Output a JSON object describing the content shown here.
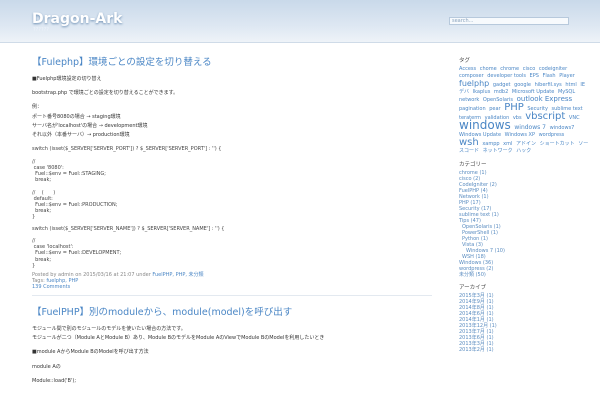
{
  "header": {
    "title": "Dragon-Ark",
    "tagline": "??????",
    "search_placeholder": "search..."
  },
  "posts": [
    {
      "title": "【Fulephp】環境ごとの設定を切り替える",
      "intro": "■Fuelphp環境設定の切り替え",
      "para1": "bootstrap.php で環境ごとの設定を切り替えることができます。",
      "notes": [
        "例：",
        "ポート番号8080の場合 → staging環境",
        "サーバ名が'localhost'の場合 → development環境",
        "それ以外（本番サーバ）→ production環境"
      ],
      "code1": [
        "switch (isset($_SERVER['SERVER_PORT']) ? $_SERVER['SERVER_PORT'] : '') {",
        "",
        "//",
        " case '8080':",
        "  Fuel::$env = Fuel::STAGING;",
        "  break;",
        "",
        "//    (      )",
        " default:",
        "  Fuel::$env = Fuel::PRODUCTION;",
        "  break;",
        "}"
      ],
      "code2": [
        "switch (isset($_SERVER['SERVER_NAME']) ? $_SERVER['SERVER_NAME'] : '') {",
        "",
        "//",
        " case 'localhost':",
        "  Fuel::$env = Fuel::DEVELOPMENT;",
        "  break;",
        "}"
      ],
      "meta_prefix": "Posted by admin on 2015/03/16 at 21:07 under",
      "meta_cats": "FuelPHP, PHP, 未分類",
      "tags_label": "Tags:",
      "tags": "fuelphp, PHP",
      "comments": "139 Comments"
    },
    {
      "title": "【FuelPHP】別のmoduleから、module(model)を呼び出す",
      "intro1": "モジュール間で別のモジュールのモデルを使いたい場合の方法です。",
      "intro2": "モジュールが二つ（Module AとModule B）あり、Module BのモデルをModule AのViewでModule BのModelを利用したいとき",
      "intro3": "■module AからModule BのModelを呼び出す方法",
      "line1": "module Aの",
      "line2": "Module::load('B');"
    }
  ],
  "sidebar": {
    "tags_heading": "タグ",
    "tag_cloud": [
      "Access",
      "chome",
      "chrome",
      "cisco",
      "codeigniter",
      "composer",
      "developer tools",
      "EPS",
      "Flash",
      "Player",
      "fuelphp",
      "gadget",
      "google",
      "hiberfil.sys",
      "html",
      "IEデバ",
      "Ikaplus",
      "mdb2",
      "Microsoft Update",
      "MySQL",
      "network",
      "OpenSolaris",
      "outlook Express",
      "pagination",
      "pear",
      "PHP",
      "Security",
      "sublime text",
      "teraterm",
      "validation",
      "vbs",
      "vbscript",
      "VNC",
      "windows",
      "windows 7",
      "windows7",
      "Windows Update",
      "Windows XP",
      "wordpress",
      "wsh",
      "xampp",
      "xml",
      "アドイン",
      "ショートカット",
      "ソースコード",
      "ネットワーク",
      "ハック"
    ],
    "cat_heading": "カテゴリー",
    "categories": [
      {
        "label": "chrome (1)",
        "level": 0
      },
      {
        "label": "cisco (2)",
        "level": 0
      },
      {
        "label": "CodeIgniter (2)",
        "level": 0
      },
      {
        "label": "FuelPHP (4)",
        "level": 0
      },
      {
        "label": "Network (1)",
        "level": 0
      },
      {
        "label": "PHP (17)",
        "level": 0
      },
      {
        "label": "Security (17)",
        "level": 0
      },
      {
        "label": "sublime text (1)",
        "level": 0
      },
      {
        "label": "Tips (47)",
        "level": 0
      },
      {
        "label": "OpenSolaris (1)",
        "level": 1
      },
      {
        "label": "PowerShell (1)",
        "level": 1
      },
      {
        "label": "Python (1)",
        "level": 1
      },
      {
        "label": "Vista (3)",
        "level": 1
      },
      {
        "label": "Windows 7 (10)",
        "level": 2
      },
      {
        "label": "WSH (18)",
        "level": 1
      },
      {
        "label": "Windows (36)",
        "level": 0
      },
      {
        "label": "wordpress (2)",
        "level": 0
      },
      {
        "label": "未分類 (50)",
        "level": 0
      }
    ],
    "archive_heading": "アーカイブ",
    "archives": [
      "2015年3月 (1)",
      "2014年9月 (1)",
      "2014年8月 (1)",
      "2014年6月 (1)",
      "2014年1月 (1)",
      "2013年12月 (1)",
      "2013年7月 (1)",
      "2013年6月 (1)",
      "2013年3月 (1)",
      "2013年2月 (1)"
    ]
  }
}
